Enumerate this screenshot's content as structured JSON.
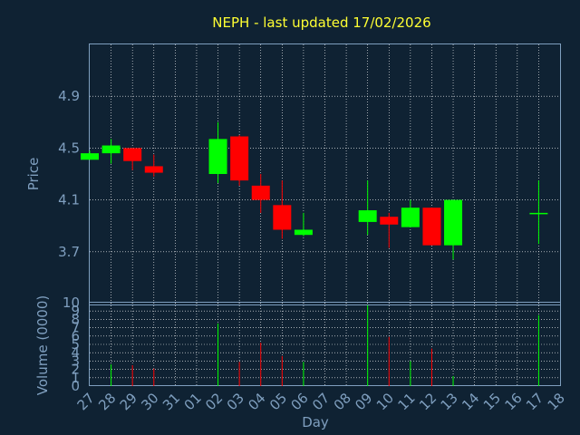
{
  "chart_data": {
    "type": "candlestick",
    "title": "NEPH - last updated 17/02/2026",
    "x_ticks": [
      "27",
      "28",
      "29",
      "30",
      "31",
      "01",
      "02",
      "03",
      "04",
      "05",
      "06",
      "07",
      "08",
      "09",
      "10",
      "11",
      "12",
      "13",
      "14",
      "15",
      "16",
      "17",
      "18"
    ],
    "price_axis": {
      "label": "Price",
      "ticks": [
        3.7,
        4.1,
        4.5,
        4.9
      ],
      "tick_labels": [
        "3.7",
        "4.1",
        "4.5",
        "4.9"
      ],
      "ylim": [
        3.3,
        5.3
      ]
    },
    "volume_axis": {
      "label": "Volume (0000)",
      "ticks": [
        0,
        1,
        2,
        3,
        4,
        5,
        6,
        7,
        8,
        9,
        10
      ],
      "tick_labels": [
        "0",
        "1",
        "2",
        "3",
        "4",
        "5",
        "6",
        "7",
        "8",
        "9",
        "10"
      ],
      "ylim": [
        0,
        10
      ]
    },
    "xlabel": "Day",
    "grid": true,
    "candles": [
      {
        "day": "27",
        "open": 4.41,
        "high": 4.48,
        "low": 4.41,
        "close": 4.46
      },
      {
        "day": "28",
        "open": 4.46,
        "high": 4.57,
        "low": 4.38,
        "close": 4.52
      },
      {
        "day": "29",
        "open": 4.5,
        "high": 4.5,
        "low": 4.33,
        "close": 4.4
      },
      {
        "day": "30",
        "open": 4.36,
        "high": 4.45,
        "low": 4.28,
        "close": 4.31
      },
      {
        "day": "02",
        "open": 4.3,
        "high": 4.7,
        "low": 4.23,
        "close": 4.57
      },
      {
        "day": "03",
        "open": 4.59,
        "high": 4.6,
        "low": 4.21,
        "close": 4.25
      },
      {
        "day": "04",
        "open": 4.21,
        "high": 4.3,
        "low": 4.0,
        "close": 4.1
      },
      {
        "day": "05",
        "open": 4.06,
        "high": 4.25,
        "low": 3.8,
        "close": 3.87
      },
      {
        "day": "06",
        "open": 3.83,
        "high": 4.0,
        "low": 3.82,
        "close": 3.87
      },
      {
        "day": "09",
        "open": 3.93,
        "high": 4.25,
        "low": 3.83,
        "close": 4.02
      },
      {
        "day": "10",
        "open": 3.97,
        "high": 4.0,
        "low": 3.73,
        "close": 3.91
      },
      {
        "day": "11",
        "open": 3.89,
        "high": 4.1,
        "low": 3.89,
        "close": 4.04
      },
      {
        "day": "12",
        "open": 4.04,
        "high": 4.04,
        "low": 3.75,
        "close": 3.75
      },
      {
        "day": "13",
        "open": 3.75,
        "high": 4.1,
        "low": 3.64,
        "close": 4.1
      },
      {
        "day": "17",
        "open": 4.0,
        "high": 4.25,
        "low": 3.76,
        "close": 4.0
      }
    ],
    "volumes": [
      {
        "day": "28",
        "value": 2.6
      },
      {
        "day": "29",
        "value": 2.5
      },
      {
        "day": "30",
        "value": 2.1
      },
      {
        "day": "02",
        "value": 7.5
      },
      {
        "day": "03",
        "value": 2.9
      },
      {
        "day": "04",
        "value": 5.2
      },
      {
        "day": "05",
        "value": 3.6
      },
      {
        "day": "06",
        "value": 2.9
      },
      {
        "day": "09",
        "value": 9.7
      },
      {
        "day": "10",
        "value": 5.9
      },
      {
        "day": "11",
        "value": 3.0
      },
      {
        "day": "12",
        "value": 4.5
      },
      {
        "day": "13",
        "value": 1.2
      },
      {
        "day": "17",
        "value": 8.5
      }
    ],
    "colors": {
      "up": "#00ff00",
      "down": "#ff0000",
      "grid": "#ffffff",
      "axis": "#7f9fbf",
      "background": "#0f2233",
      "title": "#ffff33"
    }
  }
}
